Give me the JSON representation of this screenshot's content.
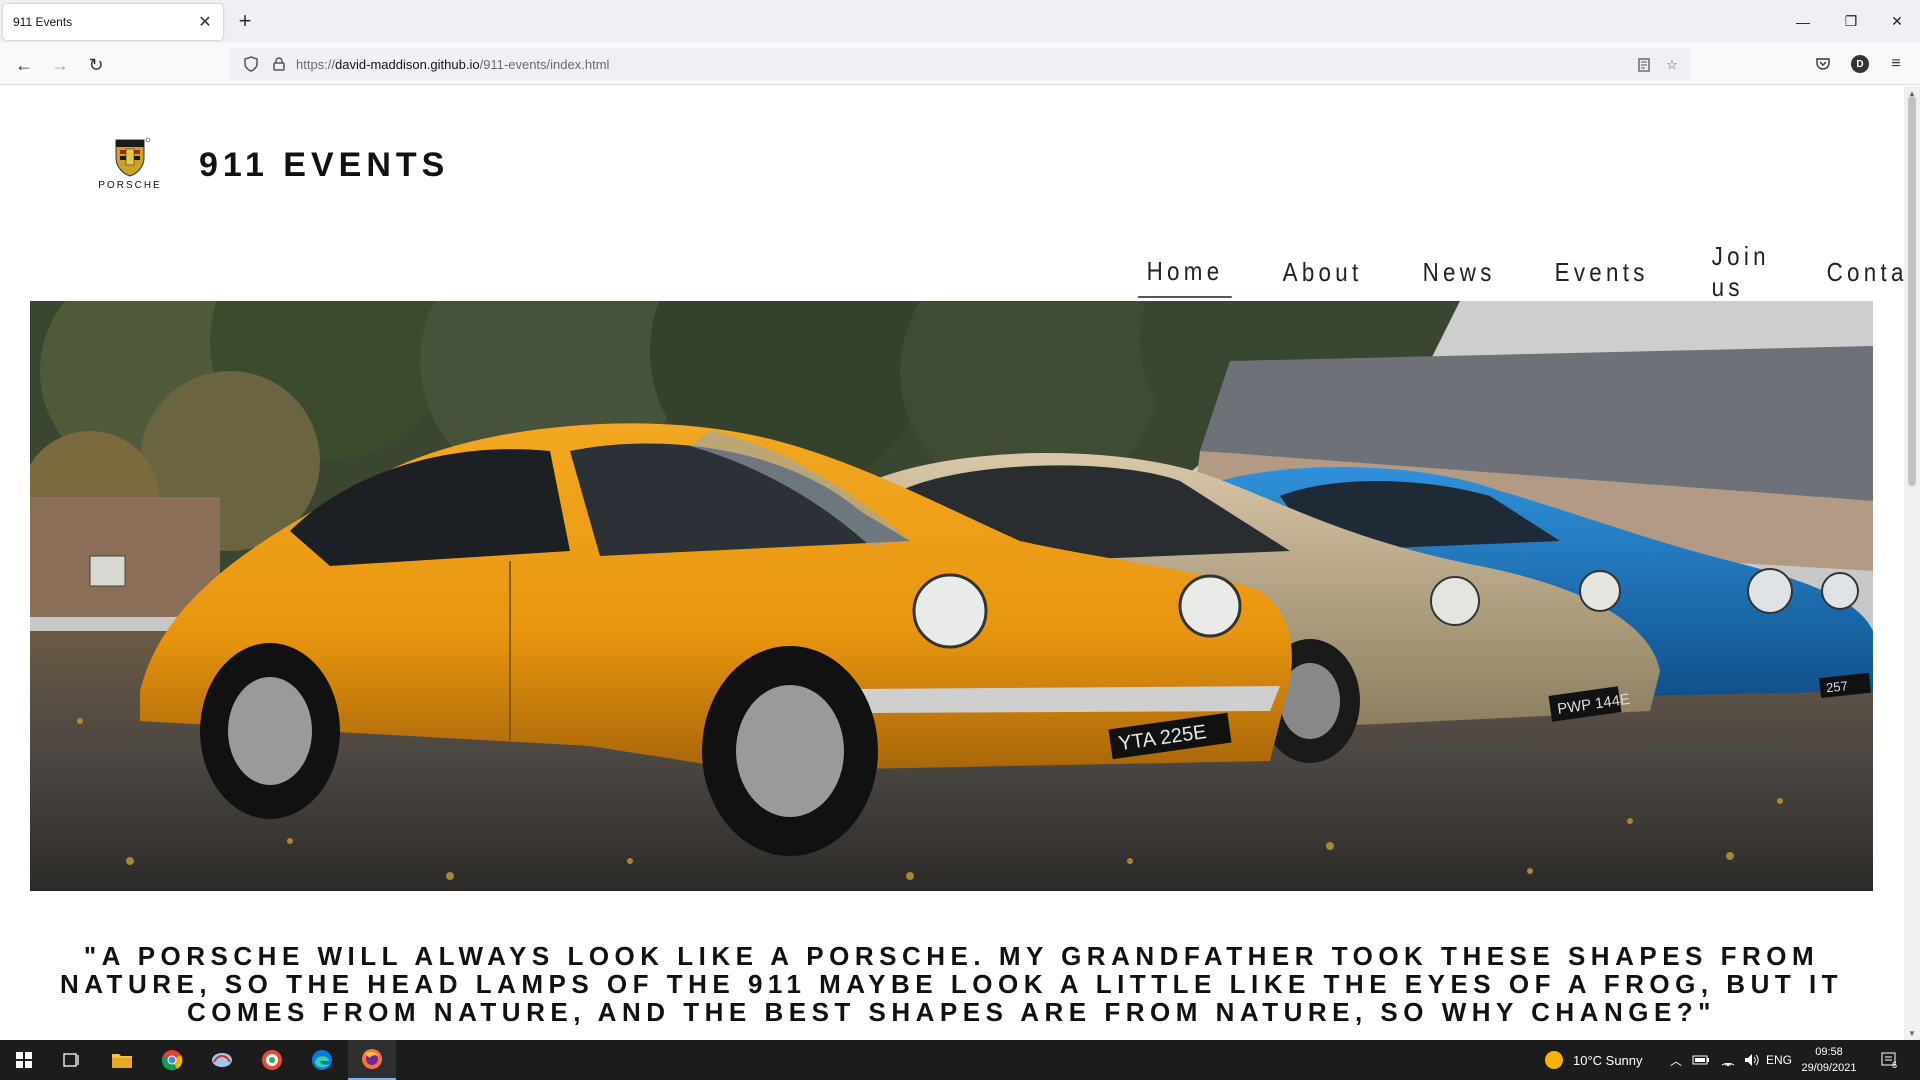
{
  "browser": {
    "tab_title": "911 Events",
    "url_prefix": "https://",
    "url_domain": "david-maddison.github.io",
    "url_path": "/911-events/index.html",
    "profile_initial": "D"
  },
  "site": {
    "logo_text": "PORSCHE",
    "title": "911 EVENTS",
    "nav": [
      "Home",
      "About",
      "News",
      "Events",
      "Join us",
      "Contact"
    ],
    "active_nav": "Home",
    "quote": "\"A Porsche will always look like a Porsche. My grandfather took these shapes from nature, so the head lamps of the 911 maybe look a little like the eyes of a frog, but it comes from nature, and the best shapes are from nature, so why change?\""
  },
  "hero": {
    "plates": [
      "YTA 225E",
      "PWP 144E",
      "257"
    ]
  },
  "taskbar": {
    "weather": "10°C  Sunny",
    "lang": "ENG",
    "time": "09:58",
    "date": "29/09/2021",
    "notif_count": "6"
  },
  "colors": {
    "orange_car": "#e8960f",
    "beige_car": "#c7b596",
    "blue_car": "#1d79c2"
  }
}
